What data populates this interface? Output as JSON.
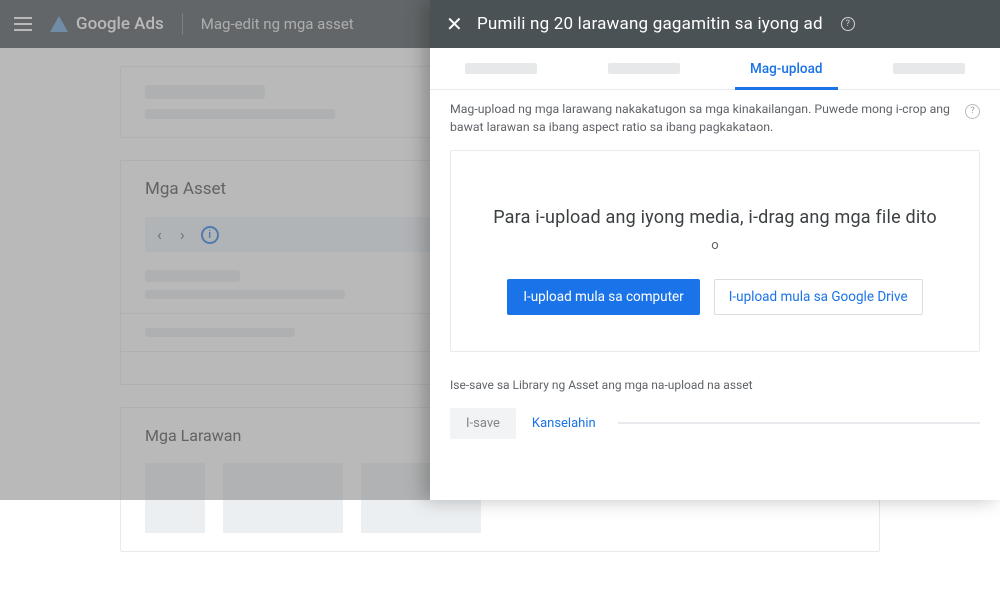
{
  "header": {
    "product": "Google Ads",
    "breadcrumb": "Mag-edit ng mga asset"
  },
  "background": {
    "section_assets_title": "Mga Asset",
    "section_images_title": "Mga Larawan"
  },
  "panel": {
    "title": "Pumili ng 20 larawang gagamitin sa iyong ad",
    "tabs": {
      "upload": "Mag-upload"
    },
    "description": "Mag-upload ng mga larawang nakakatugon sa mga kinakailangan. Puwede mong i-crop ang bawat larawan sa ibang aspect ratio sa ibang pagkakataon.",
    "dropzone": {
      "headline": "Para i-upload ang iyong media, i-drag ang mga file dito",
      "or": "o",
      "btn_computer": "I-upload mula sa computer",
      "btn_drive": "I-upload mula sa Google Drive"
    },
    "note": "Ise-save sa Library ng Asset ang mga na-upload na asset",
    "actions": {
      "save": "I-save",
      "cancel": "Kanselahin"
    }
  }
}
